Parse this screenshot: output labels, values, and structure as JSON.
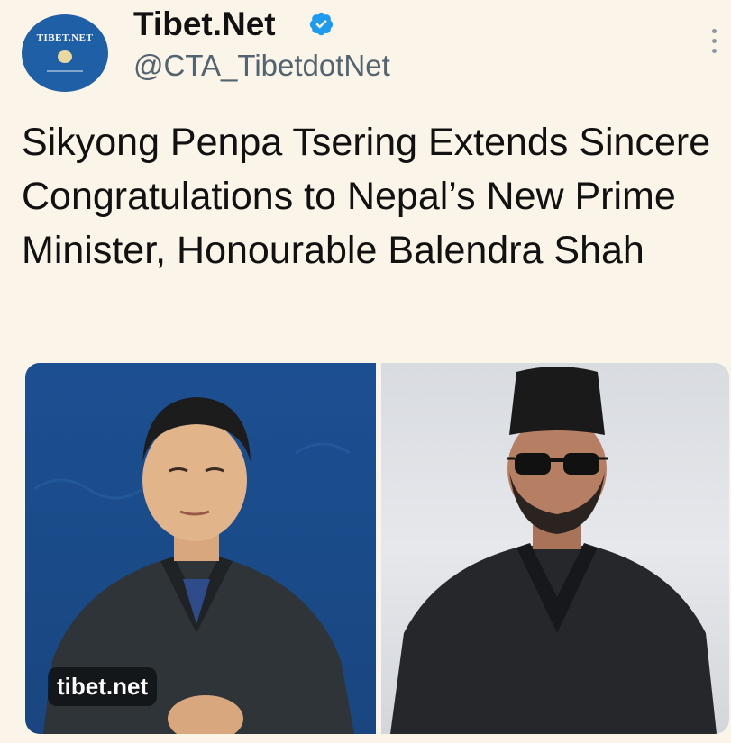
{
  "tweet": {
    "author_name": "Tibet.Net",
    "handle": "@CTA_TibetdotNet",
    "avatar_logo_text": "TIBET.NET",
    "verified": true,
    "text": "Sikyong Penpa Tsering Extends Sincere Congratulations to Nepal’s New Prime Minister, Honourable Balendra Shah"
  },
  "media": {
    "watermark": "tibet.net",
    "left_photo": {
      "subject": "Sikyong Penpa Tsering"
    },
    "right_photo": {
      "subject": "Balendra Shah"
    }
  },
  "colors": {
    "background": "#fbf4e8",
    "verified_blue": "#1d9bf0",
    "avatar_blue": "#1f5fa6"
  },
  "icons": [
    "verified-badge-icon",
    "more-options-icon"
  ]
}
